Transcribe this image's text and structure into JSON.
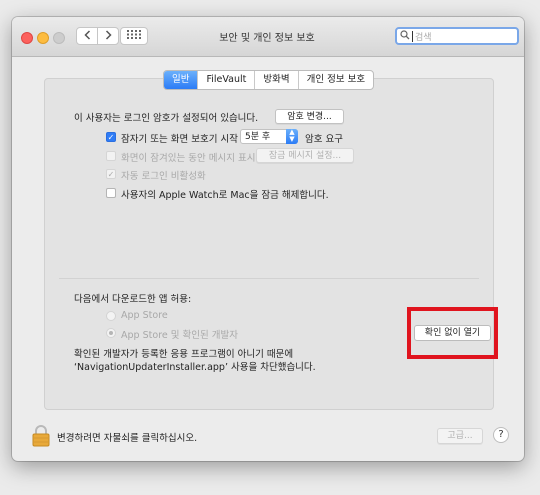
{
  "window": {
    "title": "보안 및 개인 정보 보호",
    "search_placeholder": "검색"
  },
  "tabs": [
    {
      "label": "일반",
      "active": true
    },
    {
      "label": "FileVault",
      "active": false
    },
    {
      "label": "방화벽",
      "active": false
    },
    {
      "label": "개인 정보 보호",
      "active": false
    }
  ],
  "general": {
    "login_password_text": "이 사용자는 로그인 암호가 설정되어 있습니다.",
    "change_password_button": "암호 변경...",
    "require_password": {
      "label": "잠자기 또는 화면 보호기 시작",
      "checked": true,
      "select_value": "5분 후",
      "suffix": "암호 요구"
    },
    "show_message": {
      "label": "화면이 잠겨있는 동안 메시지 표시",
      "checked": false,
      "button": "잠금 메시지 설정..."
    },
    "disable_auto_login": {
      "label": "자동 로그인 비활성화",
      "checked": true,
      "check_glyph": "✓"
    },
    "apple_watch": {
      "label": "사용자의 Apple Watch로 Mac을 잠금 해제합니다.",
      "checked": false
    }
  },
  "downloads": {
    "heading": "다음에서 다운로드한 앱 허용:",
    "options": [
      {
        "label": "App Store",
        "selected": false
      },
      {
        "label": "App Store 및 확인된 개발자",
        "selected": true
      }
    ],
    "blocked_message_line1": "확인된 개발자가 등록한 응용 프로그램이 아니기 때문에",
    "blocked_message_line2": "‘NavigationUpdaterInstaller.app’ 사용을 차단했습니다.",
    "open_anyway_button": "확인 없이 열기"
  },
  "footer": {
    "lock_text": "변경하려면 자물쇠를 클릭하십시오.",
    "advanced_button": "고급...",
    "help_button": "?"
  },
  "colors": {
    "accent": "#2f7cf6",
    "highlight_frame": "#e0141e"
  }
}
